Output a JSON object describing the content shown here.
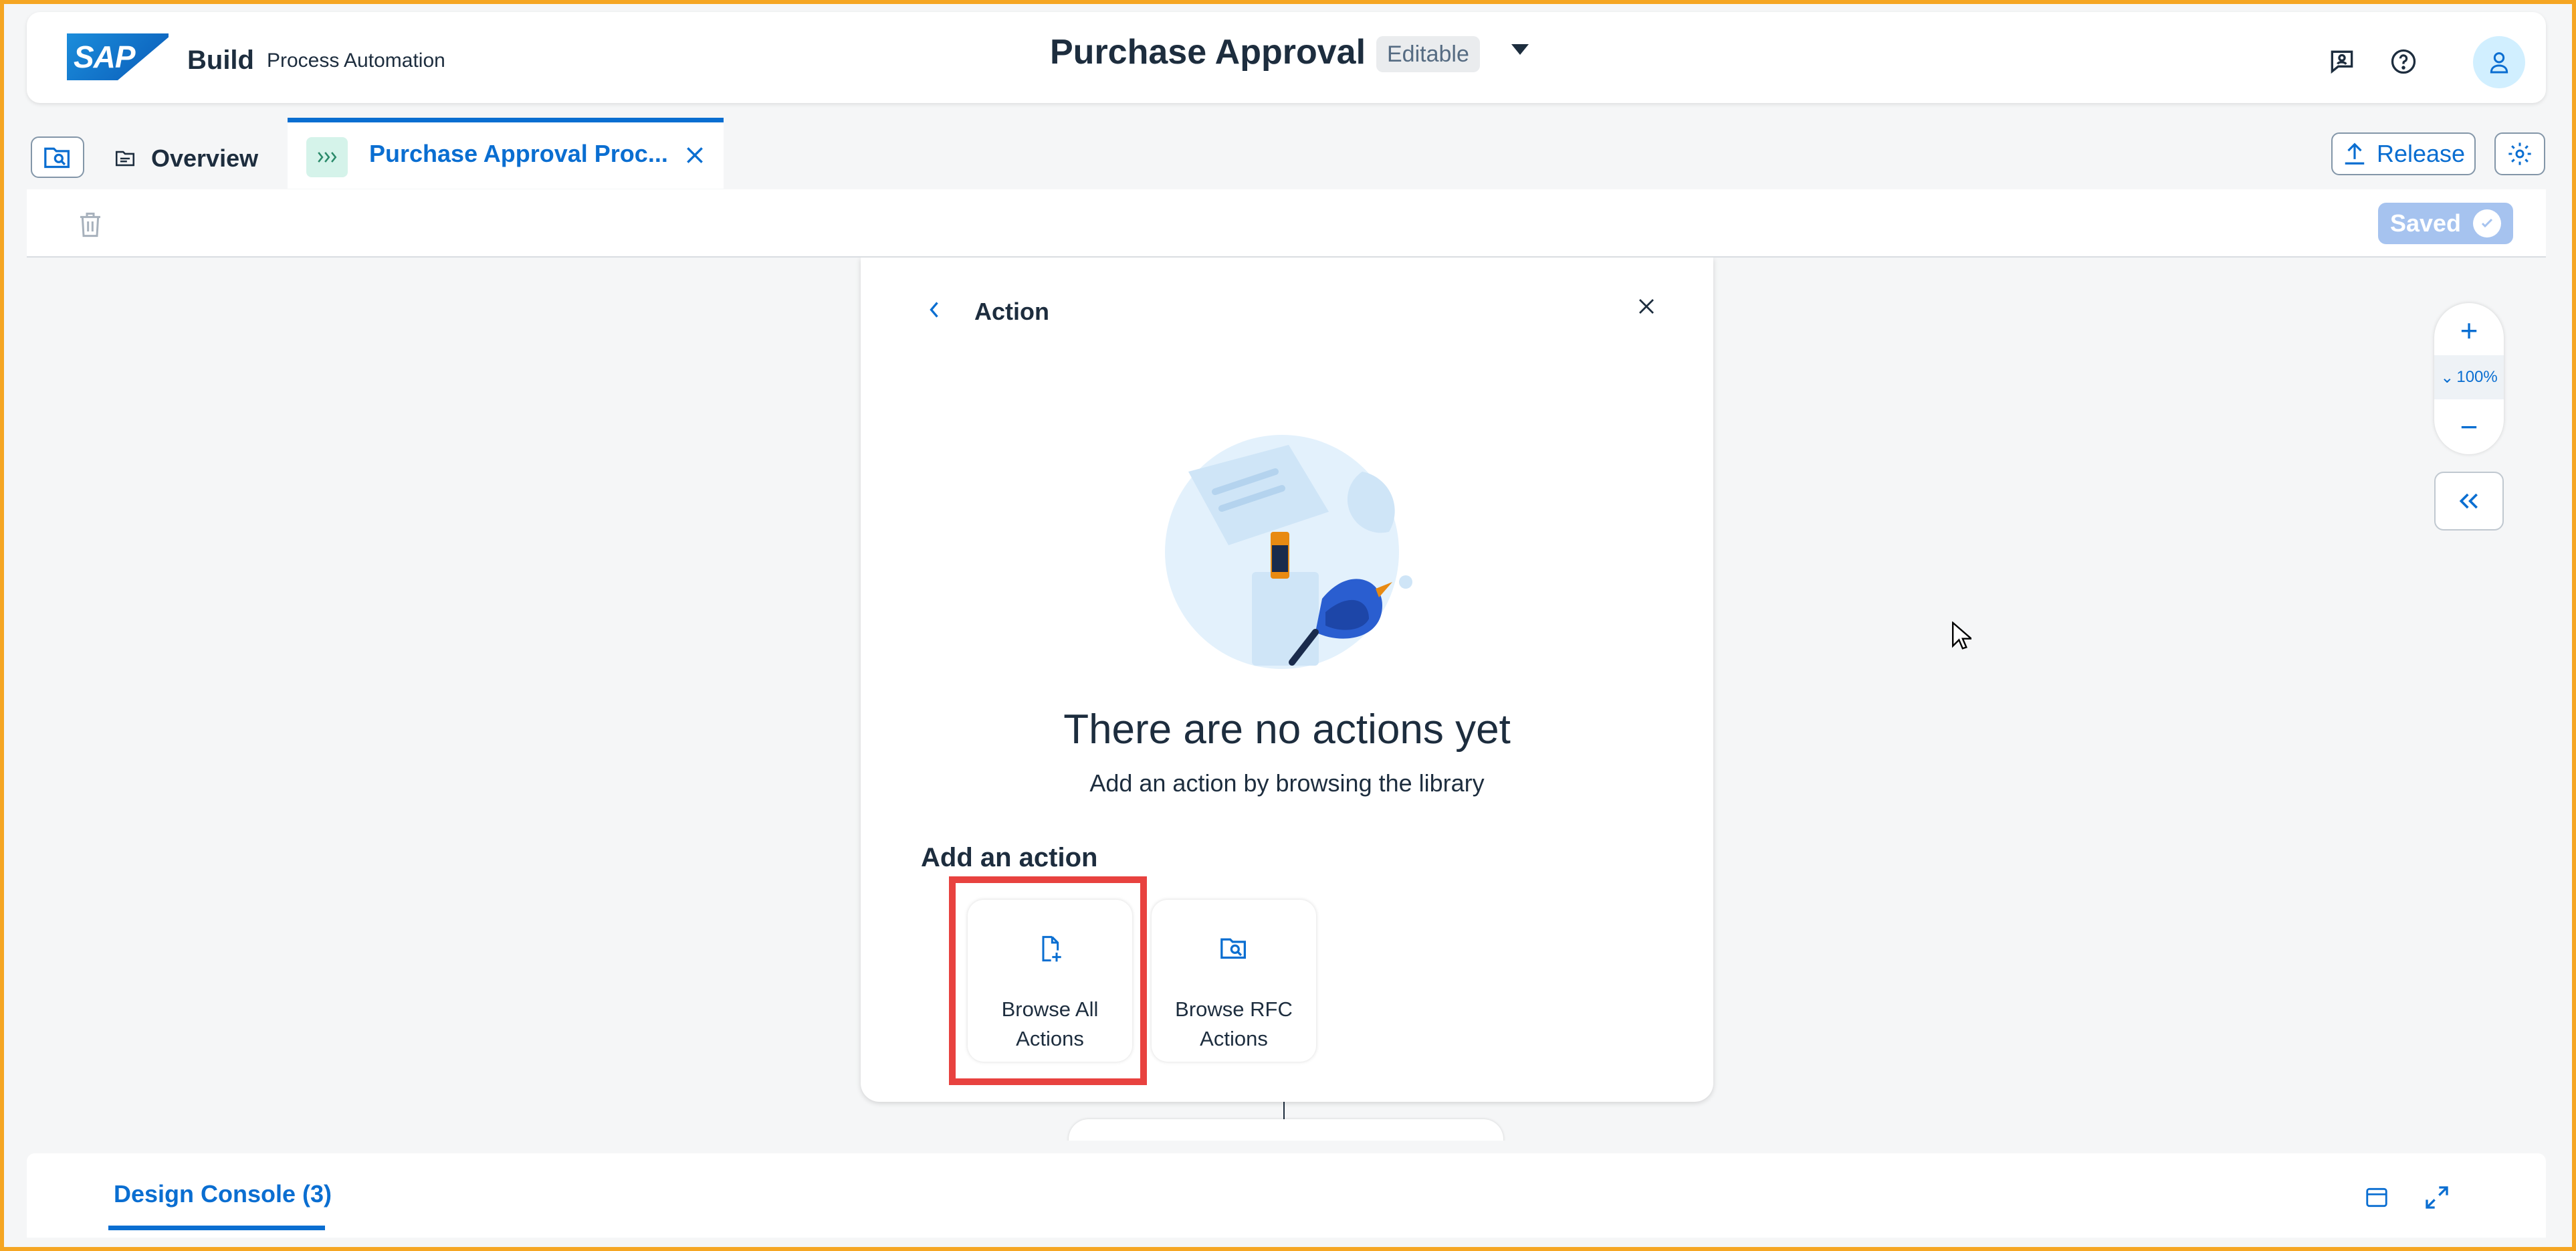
{
  "shell": {
    "logo_text": "SAP",
    "brand": "Build",
    "brand_sub": "Process Automation",
    "document_title": "Purchase Approval",
    "status_badge": "Editable"
  },
  "tabs": {
    "overview_label": "Overview",
    "active_label": "Purchase Approval Proc..."
  },
  "toolbar": {
    "release_label": "Release",
    "saved_label": "Saved"
  },
  "zoom": {
    "level": "100%"
  },
  "panel": {
    "title": "Action",
    "empty_title": "There are no actions yet",
    "empty_subtitle": "Add an action by browsing the library",
    "add_heading": "Add an action",
    "cards": [
      {
        "label_line1": "Browse All",
        "label_line2": "Actions"
      },
      {
        "label_line1": "Browse RFC",
        "label_line2": "Actions"
      }
    ]
  },
  "console": {
    "tab_label": "Design Console (3)"
  },
  "colors": {
    "accent": "#0a6ed1",
    "highlight": "#e8423f",
    "frame": "#f5a623"
  }
}
